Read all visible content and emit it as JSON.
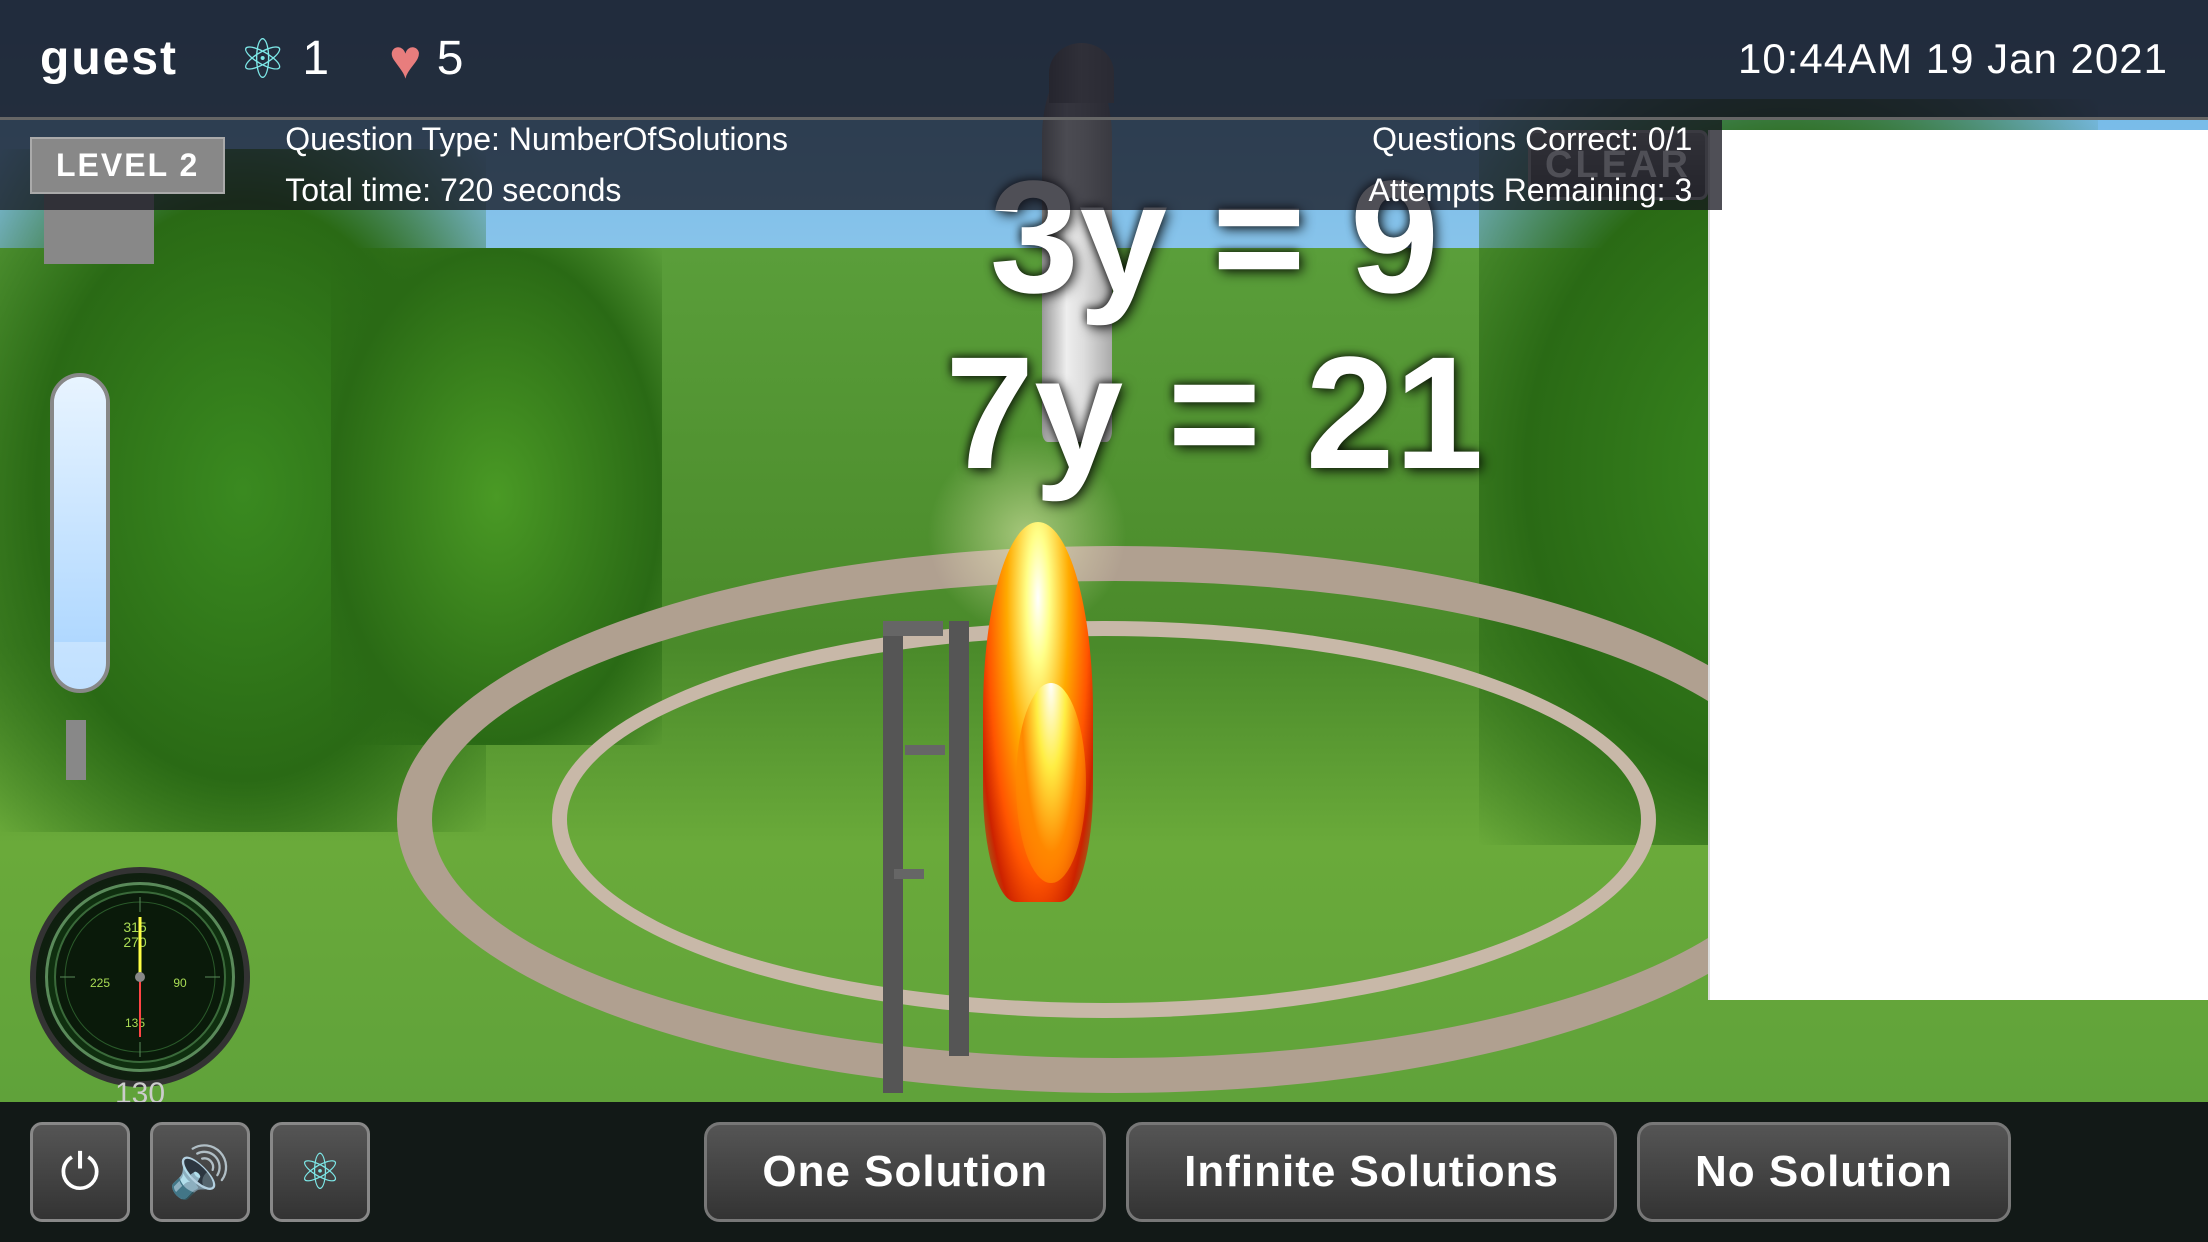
{
  "header": {
    "username": "guest",
    "atom_count": "1",
    "heart_count": "5",
    "datetime": "10:44AM  19 Jan 2021"
  },
  "info_bar": {
    "level": "LEVEL 2",
    "question_type_label": "Question Type: NumberOfSolutions",
    "total_time_label": "Total time: 720 seconds",
    "questions_correct_label": "Questions Correct: 0/1",
    "attempts_remaining_label": "Attempts Remaining: 3"
  },
  "equation": {
    "line1": "3y = 9",
    "line2": "7y = 21"
  },
  "buttons": {
    "one_solution": "One Solution",
    "infinite_solutions": "Infinite Solutions",
    "no_solution": "No Solution",
    "clear": "CLEAR"
  },
  "compass": {
    "value": "130"
  },
  "icons": {
    "power": "⏻",
    "sound": "🔊",
    "atom": "⚛"
  }
}
